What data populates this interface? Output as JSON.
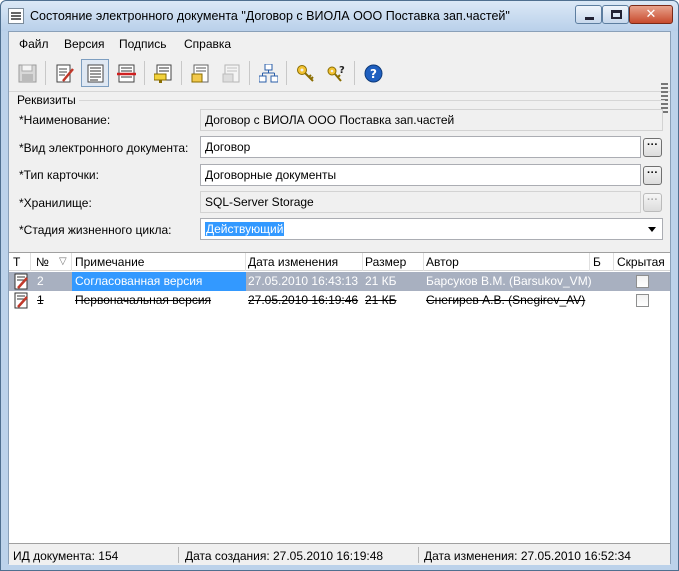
{
  "window": {
    "title": "Состояние электронного документа \"Договор с ВИОЛА ООО Поставка зап.частей\"",
    "minimize_glyph": "",
    "maximize_glyph": "",
    "close_glyph": "✕"
  },
  "menu": {
    "items": [
      {
        "label": "Файл"
      },
      {
        "label": "Версия"
      },
      {
        "label": "Подпись"
      },
      {
        "label": "Справка"
      }
    ]
  },
  "toolbar": {
    "buttons": [
      {
        "icon": "save-icon"
      },
      {
        "icon": "edit-document-icon"
      },
      {
        "icon": "view-document-icon"
      },
      {
        "icon": "delete-document-icon"
      },
      {
        "icon": "sign-document-icon"
      },
      {
        "icon": "lock-document-icon"
      },
      {
        "icon": "unlock-document-icon"
      },
      {
        "icon": "hierarchy-icon"
      },
      {
        "icon": "key-icon"
      },
      {
        "icon": "key-question-icon"
      },
      {
        "icon": "help-icon"
      }
    ]
  },
  "requisites": {
    "group_label": "Реквизиты",
    "name_label": "*Наименование:",
    "name_value": "Договор с ВИОЛА ООО Поставка зап.частей",
    "doc_type_label": "*Вид электронного документа:",
    "doc_type_value": "Договор",
    "card_type_label": "*Тип карточки:",
    "card_type_value": "Договорные документы",
    "storage_label": "*Хранилище:",
    "storage_value": "SQL-Server Storage",
    "lifecycle_label": "*Стадия жизненного цикла:",
    "lifecycle_value": "Действующий",
    "dots": "···"
  },
  "versions_table": {
    "columns": [
      "Т",
      "№",
      "Примечание",
      "Дата изменения",
      "Размер",
      "Автор",
      "Б",
      "Скрытая"
    ],
    "sort_indicator": "▽",
    "rows": [
      {
        "number": "2",
        "note": "Согласованная версия",
        "date": "27.05.2010 16:43:13",
        "size": "21 КБ",
        "author": "Барсуков В.М. (Barsukov_VM)",
        "hidden": false
      },
      {
        "number": "1",
        "note": "Первоначальная версия",
        "date": "27.05.2010 16:19:46",
        "size": "21 КБ",
        "author": "Снегирев А.В. (Snegirev_AV)",
        "hidden": false
      }
    ]
  },
  "status": {
    "doc_id": "ИД документа: 154",
    "created": "Дата создания: 27.05.2010 16:19:48",
    "modified": "Дата изменения: 27.05.2010 16:52:34"
  }
}
